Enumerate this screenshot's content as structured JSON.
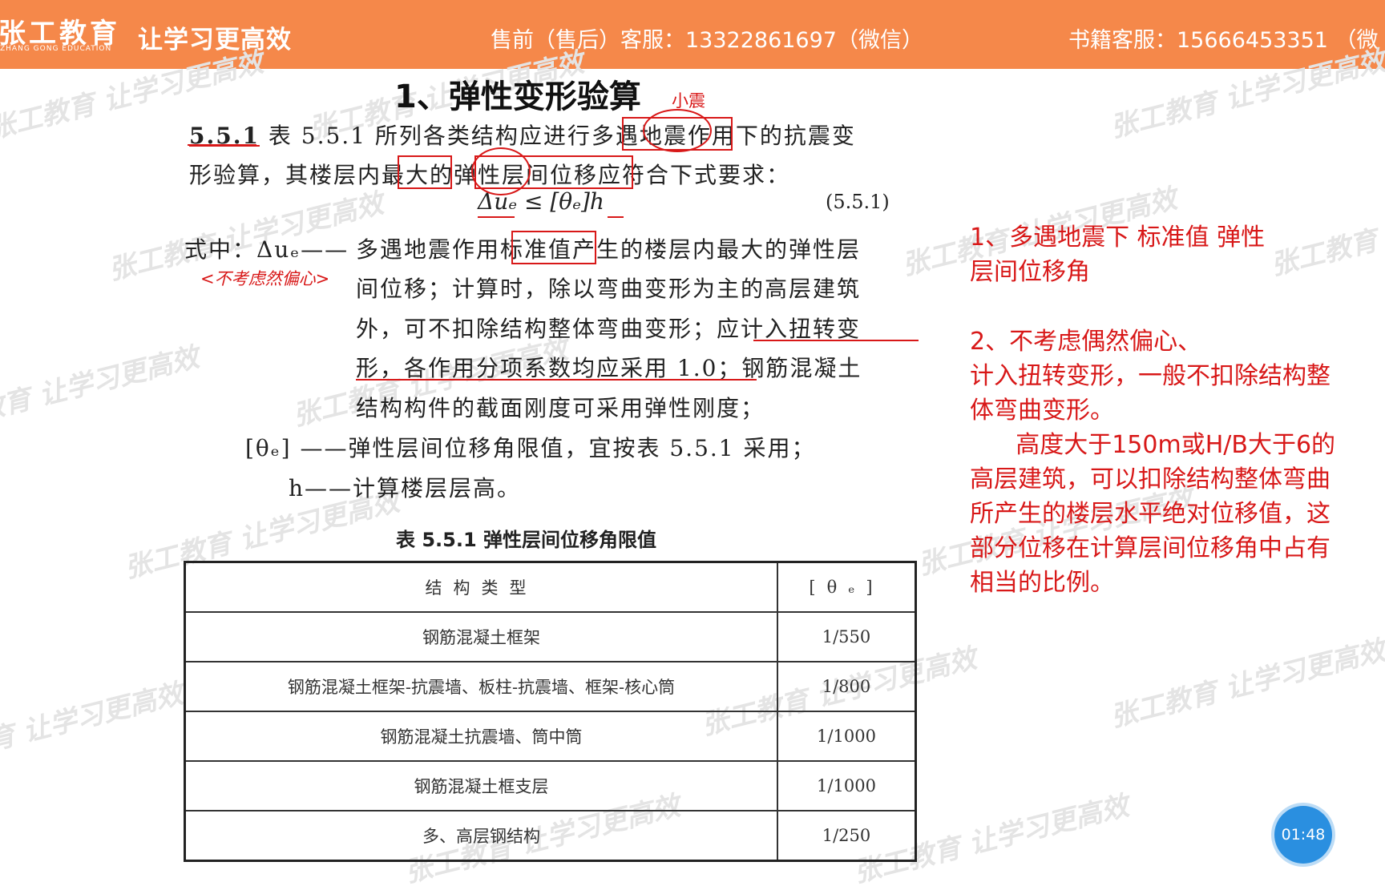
{
  "banner": {
    "logo_zh": "张工教育",
    "logo_en": "ZHANG GONG EDUCATION",
    "slogan": "让学习更高效",
    "presale": "售前（售后）客服：13322861697（微信）",
    "books": "书籍客服：15666453351 （微"
  },
  "watermark_text": "张工教育 让学习更高效",
  "document": {
    "title": "1、弹性变形验算",
    "annotation_small_quake": "小震",
    "clause_num": "5.5.1",
    "para1_line1": "表 5.5.1 所列各类结构应进行多遇地震作用下的抗震变",
    "para1_line2": "形验算，其楼层内最大的弹性层间位移应符合下式要求：",
    "equation": "Δuₑ ≤ [θₑ]h",
    "equation_number": "(5.5.1)",
    "where_label": "式中：Δuₑ——",
    "def1_line1": "多遇地震作用标准值产生的楼层内最大的弹性层",
    "def1_line2": "间位移；计算时，除以弯曲变形为主的高层建筑",
    "def1_line3": "外，可不扣除结构整体弯曲变形；应计入扭转变",
    "def1_line4": "形，各作用分项系数均应采用 1.0；钢筋混凝土",
    "def1_line5": "结构构件的截面刚度可采用弹性刚度；",
    "annotation_note": "<不考虑然偏心>",
    "def2": "[θₑ] ——弹性层间位移角限值，宜按表 5.5.1 采用；",
    "def3": "h——计算楼层层高。"
  },
  "table": {
    "caption": "表 5.5.1   弹性层间位移角限值",
    "header": [
      "结构类型",
      "[θₑ]"
    ],
    "rows": [
      [
        "钢筋混凝土框架",
        "1/550"
      ],
      [
        "钢筋混凝土框架-抗震墙、板柱-抗震墙、框架-核心筒",
        "1/800"
      ],
      [
        "钢筋混凝土抗震墙、筒中筒",
        "1/1000"
      ],
      [
        "钢筋混凝土框支层",
        "1/1000"
      ],
      [
        "多、高层钢结构",
        "1/250"
      ]
    ]
  },
  "notes": {
    "n1_line1": "1、多遇地震下  标准值  弹性",
    "n1_line2": "层间位移角",
    "n2_line1": "2、不考虑偶然偏心、",
    "n2_line2": "计入扭转变形，一般不扣除结构整",
    "n2_line3": "体弯曲变形。",
    "n2_line4": "      高度大于150m或H/B大于6的",
    "n2_line5": "高层建筑，可以扣除结构整体弯曲",
    "n2_line6": "所产生的楼层水平绝对位移值，这",
    "n2_line7": "部分位移在计算层间位移角中占有",
    "n2_line8": "相当的比例。"
  },
  "timer": "01:48",
  "colors": {
    "banner": "#f5884a",
    "annotation_red": "#d81818",
    "timer_blue": "#2a8fe0"
  }
}
